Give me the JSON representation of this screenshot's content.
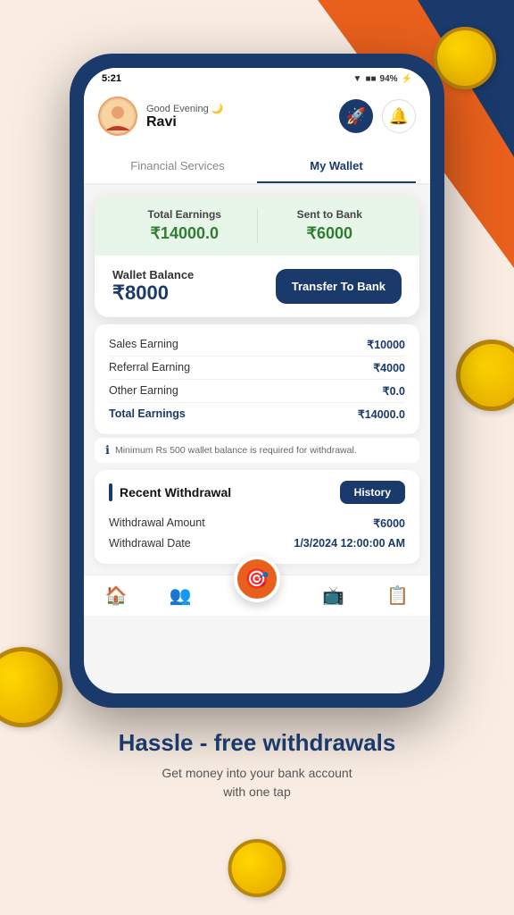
{
  "status_bar": {
    "time": "5:21",
    "battery": "94%",
    "battery_icon": "⚡"
  },
  "header": {
    "greeting": "Good Evening 🌙",
    "user_name": "Ravi",
    "rocket_icon": "🚀",
    "bell_icon": "🔔"
  },
  "tabs": [
    {
      "label": "Financial Services",
      "active": false
    },
    {
      "label": "My Wallet",
      "active": true
    }
  ],
  "earnings": {
    "total_earnings_label": "Total Earnings",
    "total_earnings_value": "₹14000.0",
    "sent_to_bank_label": "Sent to Bank",
    "sent_to_bank_value": "₹6000",
    "wallet_balance_label": "Wallet Balance",
    "wallet_balance_value": "₹8000",
    "transfer_btn_label": "Transfer To Bank"
  },
  "breakdown": [
    {
      "label": "Sales Earning",
      "value": "₹10000"
    },
    {
      "label": "Referral Earning",
      "value": "₹4000"
    },
    {
      "label": "Other Earning",
      "value": "₹0.0"
    },
    {
      "label": "Total Earnings",
      "value": "₹14000.0",
      "is_total": true
    }
  ],
  "info_note": "Minimum Rs 500 wallet balance is required for withdrawal.",
  "recent_withdrawal": {
    "title": "Recent Withdrawal",
    "history_btn_label": "History",
    "rows": [
      {
        "label": "Withdrawal Amount",
        "value": "₹6000"
      },
      {
        "label": "Withdrawal Date",
        "value": "1/3/2024 12:00:00 AM"
      }
    ]
  },
  "bottom_nav": [
    {
      "icon": "🏠",
      "label": "Home"
    },
    {
      "icon": "👥",
      "label": "Team"
    },
    {
      "icon": "🎯",
      "label": "Center",
      "is_center": true
    },
    {
      "icon": "📺",
      "label": "Videos"
    },
    {
      "icon": "📋",
      "label": "Tasks"
    }
  ],
  "bottom_section": {
    "headline": "Hassle - free withdrawals",
    "subtext": "Get money into your bank account\nwith one tap"
  }
}
